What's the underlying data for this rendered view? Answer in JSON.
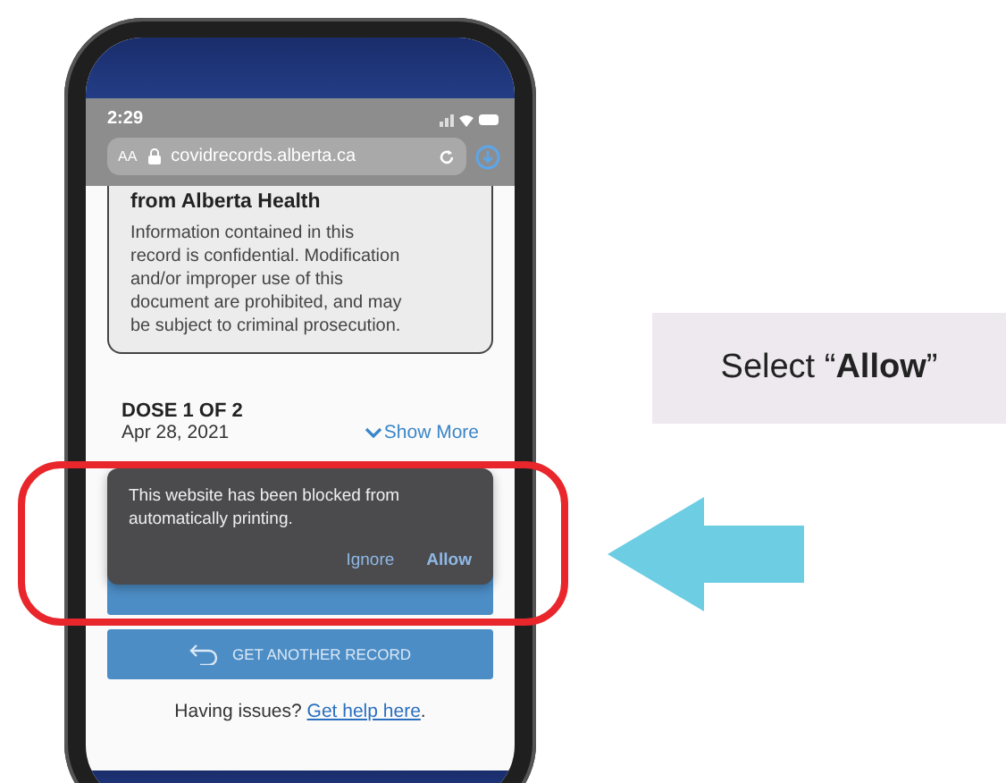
{
  "phone": {
    "status_bar": {
      "time": "2:29"
    },
    "address_bar": {
      "text_size": "AA",
      "url": "covidrecords.alberta.ca"
    },
    "notice": {
      "title": "from Alberta Health",
      "text": "Information contained in this record is confidential. Modification and/or improper use of this document are prohibited, and may be subject to criminal prosecution."
    },
    "dose": {
      "title": "DOSE 1 OF 2",
      "date": "Apr 28, 2021",
      "toggle": "Show More"
    },
    "popup": {
      "message": "This website has been blocked from automatically printing.",
      "buttons": [
        {
          "label": "Ignore",
          "kind": "secondary"
        },
        {
          "label": "Allow",
          "kind": "primary"
        }
      ]
    },
    "record_button": "GET ANOTHER RECORD",
    "help": {
      "text": "Having issues?",
      "link": "Get help here",
      "after": "."
    }
  },
  "callout": {
    "text": "Select “**Allow**”"
  }
}
